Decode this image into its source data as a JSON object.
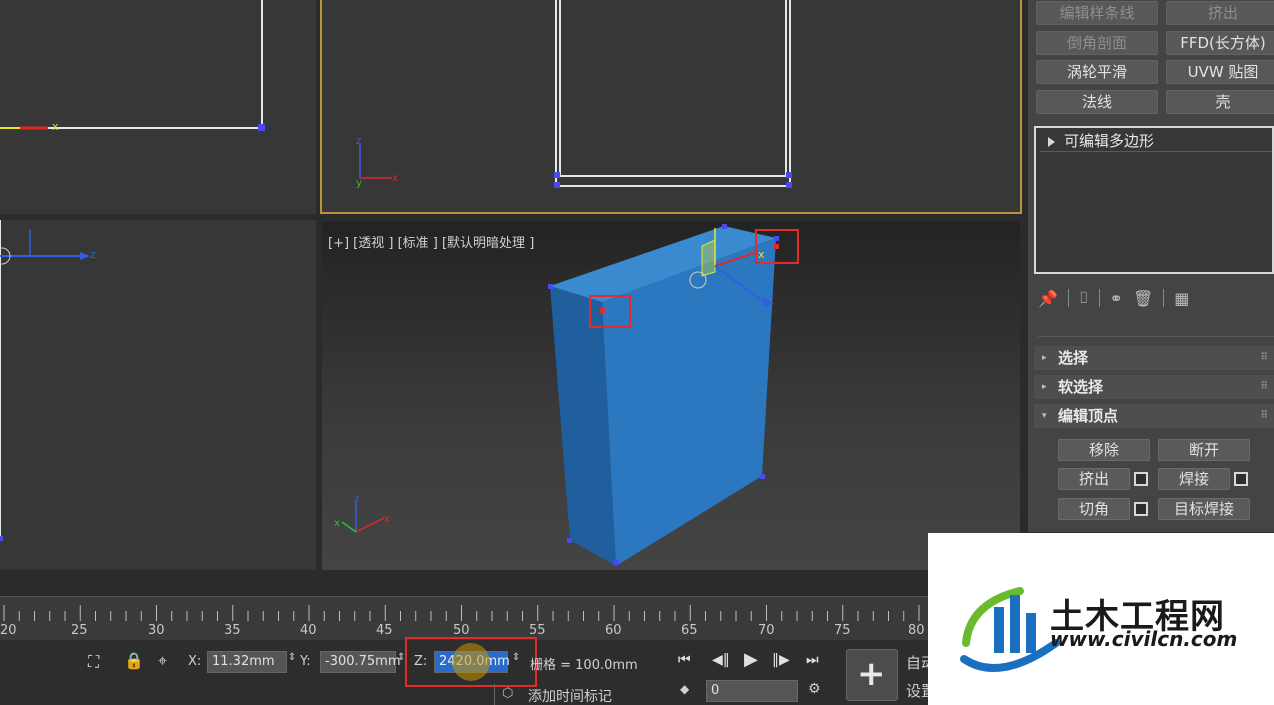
{
  "viewport_perspective": {
    "label": "[+] [透视 ] [标准 ] [默认明暗处理 ]"
  },
  "modifier_buttons": [
    {
      "label": "编辑样条线",
      "enabled": false
    },
    {
      "label": "挤出",
      "enabled": false
    },
    {
      "label": "倒角剖面",
      "enabled": false
    },
    {
      "label": "FFD(长方体)",
      "enabled": true
    },
    {
      "label": "涡轮平滑",
      "enabled": true
    },
    {
      "label": "UVW 贴图",
      "enabled": true
    },
    {
      "label": "法线",
      "enabled": true
    },
    {
      "label": "壳",
      "enabled": true
    }
  ],
  "modifier_stack": {
    "items": [
      "可编辑多边形"
    ]
  },
  "rollouts": {
    "selection": "选择",
    "soft_selection": "软选择",
    "edit_vertices": "编辑顶点"
  },
  "edit_vertices_buttons": {
    "remove": "移除",
    "break": "断开",
    "extrude": "挤出",
    "weld": "焊接",
    "chamfer": "切角",
    "target_weld": "目标焊接"
  },
  "timeline": {
    "ticks": [
      "20",
      "25",
      "30",
      "35",
      "40",
      "45",
      "50",
      "55",
      "60",
      "65",
      "70",
      "75",
      "80"
    ]
  },
  "status_bar": {
    "x_label": "X:",
    "x_value": "11.32mm",
    "y_label": "Y:",
    "y_value": "-300.75mm",
    "z_label": "Z:",
    "z_value": "2420.0mm",
    "grid_text": "栅格 = 100.0mm",
    "add_time_tag": "添加时间标记",
    "frame_value": "0",
    "auto_key": "自动",
    "set_key": "设置"
  },
  "logo": {
    "name": "土木工程网",
    "url": "www.civilcn.com"
  },
  "colors": {
    "box_blue": "#2b78c0",
    "highlight_red": "#e02c2c",
    "active_border": "#b8923c"
  }
}
